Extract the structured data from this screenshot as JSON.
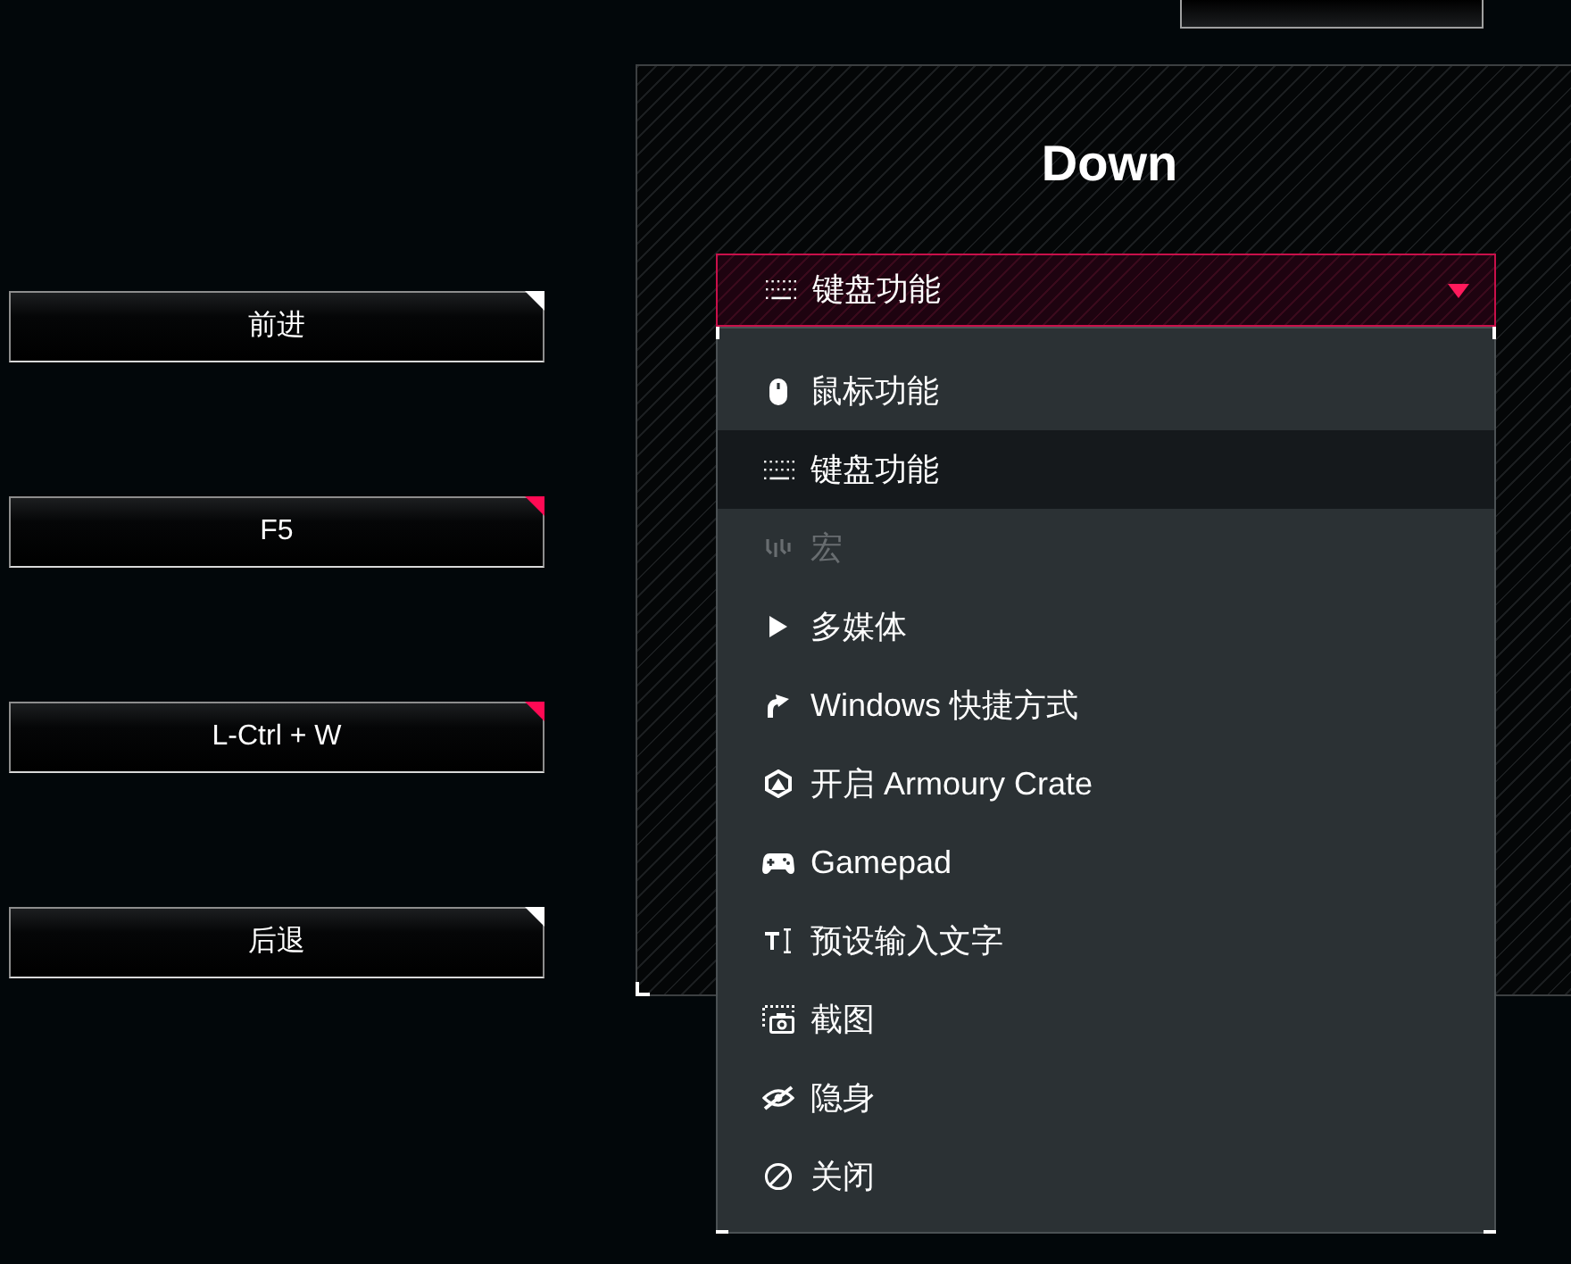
{
  "key_buttons": [
    {
      "label": "前进",
      "color": "#ffffff"
    },
    {
      "label": "F5",
      "color": "#ff0a54"
    },
    {
      "label": "L-Ctrl + W",
      "color": "#ff0a54"
    },
    {
      "label": "后退",
      "color": "#ffffff"
    }
  ],
  "panel": {
    "title": "Down",
    "dropdown": {
      "kind": "keyboard",
      "value": "键盘功能",
      "expanded": true
    },
    "menu": {
      "items": [
        {
          "kind": "mouse",
          "label": "鼠标功能",
          "selected": false,
          "disabled": false
        },
        {
          "kind": "keyboard",
          "label": "键盘功能",
          "selected": true,
          "disabled": false
        },
        {
          "kind": "macro",
          "label": "宏",
          "selected": false,
          "disabled": true
        },
        {
          "kind": "media",
          "label": "多媒体",
          "selected": false,
          "disabled": false
        },
        {
          "kind": "shortcut",
          "label": "Windows 快捷方式",
          "selected": false,
          "disabled": false
        },
        {
          "kind": "armoury",
          "label": "开启 Armoury Crate",
          "selected": false,
          "disabled": false
        },
        {
          "kind": "gamepad",
          "label": "Gamepad",
          "selected": false,
          "disabled": false
        },
        {
          "kind": "text",
          "label": "预设输入文字",
          "selected": false,
          "disabled": false
        },
        {
          "kind": "screenshot",
          "label": "截图",
          "selected": false,
          "disabled": false
        },
        {
          "kind": "hide",
          "label": "隐身",
          "selected": false,
          "disabled": false
        },
        {
          "kind": "off",
          "label": "关闭",
          "selected": false,
          "disabled": false
        }
      ]
    }
  }
}
